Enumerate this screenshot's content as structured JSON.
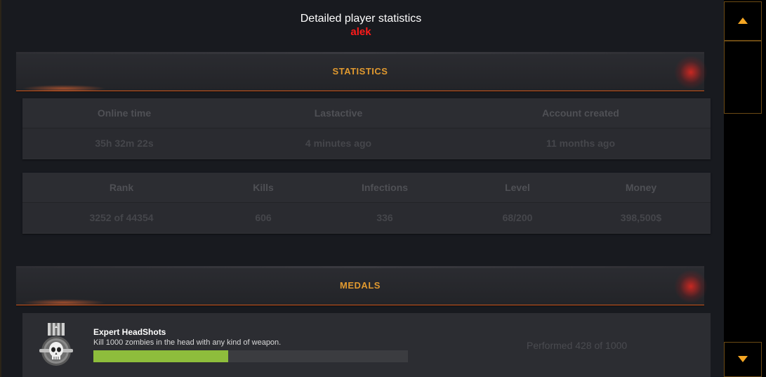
{
  "header": {
    "title": "Detailed player statistics",
    "player_name": "alek"
  },
  "sections": {
    "statistics_label": "STATISTICS",
    "medals_label": "MEDALS"
  },
  "activity_table": {
    "headers": [
      "Online time",
      "Lastactive",
      "Account created"
    ],
    "values": [
      "35h 32m 22s",
      "4 minutes ago",
      "11 months ago"
    ]
  },
  "stats_table": {
    "headers": [
      "Rank",
      "Kills",
      "Infections",
      "Level",
      "Money"
    ],
    "values": [
      "3252 of 44354",
      "606",
      "336",
      "68/200",
      "398,500$"
    ]
  },
  "medals": [
    {
      "name": "Expert HeadShots",
      "description": "Kill 1000 zombies in the head with any kind of weapon.",
      "progress": 0.428,
      "performed_text": "Performed 428 of 1000",
      "icon": "skull-medal-icon"
    }
  ],
  "scrollbar": {
    "up_icon": "arrow-up-icon",
    "down_icon": "arrow-down-icon",
    "accent": "#f5a623"
  },
  "colors": {
    "player_name": "#ff1a1a",
    "section_label": "#e0992f",
    "progress_fill": "#8ebd3c"
  }
}
